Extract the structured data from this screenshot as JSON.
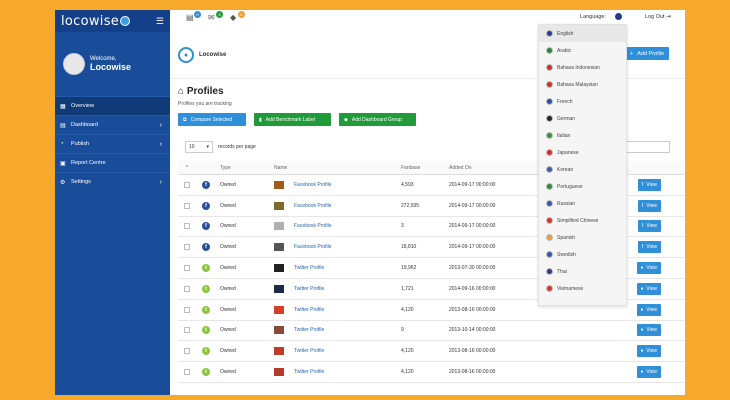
{
  "app": {
    "logo": "locowise"
  },
  "user": {
    "welcome": "Welcome,",
    "name": "Locowise"
  },
  "sidebar": {
    "items": [
      {
        "label": "Overview",
        "icon": "grid-icon",
        "active": true,
        "chevron": false
      },
      {
        "label": "Dashboard",
        "icon": "dashboard-icon",
        "active": false,
        "chevron": true
      },
      {
        "label": "Publish",
        "icon": "publish-icon",
        "active": false,
        "chevron": true
      },
      {
        "label": "Report Centre",
        "icon": "report-icon",
        "active": false,
        "chevron": false
      },
      {
        "label": "Settings",
        "icon": "gear-icon",
        "active": false,
        "chevron": true
      }
    ]
  },
  "topbar": {
    "badges": [
      {
        "icon": "book-icon",
        "count": "0",
        "color": "#2f8fd8"
      },
      {
        "icon": "mail-icon",
        "count": "4",
        "color": "#219a3a"
      },
      {
        "icon": "tag-icon",
        "count": "0",
        "color": "#f0a02a"
      }
    ],
    "language_label": "Language:",
    "logout_label": "Log Out"
  },
  "brand": {
    "name": "Locowise"
  },
  "header": {
    "add_profile_label": "Add Profile"
  },
  "page": {
    "title": "Profiles",
    "subtitle": "Profiles you are tracking",
    "buttons": [
      {
        "label": "Compare Selected",
        "style": "blue"
      },
      {
        "label": "Add Benchmark Label",
        "style": "green"
      },
      {
        "label": "Add Dashboard Group",
        "style": "green"
      }
    ],
    "records_value": "10",
    "records_label": "records per page"
  },
  "table": {
    "headers": [
      "",
      "",
      "Type",
      "Name",
      "Fanbase",
      "Added On",
      ""
    ],
    "view_label": "View",
    "rows": [
      {
        "network": "facebook",
        "type": "Owned",
        "name": "Facebook Profile",
        "fanbase": "4,593",
        "added": "2014-09-17 00:00:00",
        "thumb": "#a15a1a"
      },
      {
        "network": "facebook",
        "type": "Owned",
        "name": "Facebook Profile",
        "fanbase": "272,935",
        "added": "2014-09-17 00:00:00",
        "thumb": "#7b6a2c"
      },
      {
        "network": "facebook",
        "type": "Owned",
        "name": "Facebook Profile",
        "fanbase": "3",
        "added": "2014-09-17 00:00:00",
        "thumb": "#b0b0b0"
      },
      {
        "network": "facebook",
        "type": "Owned",
        "name": "Facebook Profile",
        "fanbase": "18,810",
        "added": "2014-09-17 00:00:00",
        "thumb": "#555"
      },
      {
        "network": "twitter",
        "type": "Owned",
        "name": "Twitter Profile",
        "fanbase": "19,962",
        "added": "2013-07-30 00:00:00",
        "thumb": "#222"
      },
      {
        "network": "twitter",
        "type": "Owned",
        "name": "Twitter Profile",
        "fanbase": "1,721",
        "added": "2014-09-16 00:00:00",
        "thumb": "#1d2a4a"
      },
      {
        "network": "twitter",
        "type": "Owned",
        "name": "Twitter Profile",
        "fanbase": "4,120",
        "added": "2013-08-16 00:00:00",
        "thumb": "#d3412b"
      },
      {
        "network": "twitter",
        "type": "Owned",
        "name": "Twitter Profile",
        "fanbase": "9",
        "added": "2013-10-14 00:00:00",
        "thumb": "#8a4a3a"
      },
      {
        "network": "twitter",
        "type": "Owned",
        "name": "Twitter Profile",
        "fanbase": "4,120",
        "added": "2013-08-16 00:00:00",
        "thumb": "#c43a2a"
      },
      {
        "network": "twitter",
        "type": "Owned",
        "name": "Twitter Profile",
        "fanbase": "4,120",
        "added": "2013-08-16 00:00:00",
        "thumb": "#b53a28"
      }
    ]
  },
  "languages": [
    {
      "label": "English",
      "color": "#1f3f8f"
    },
    {
      "label": "Arabic",
      "color": "#1b8a3a"
    },
    {
      "label": "Bahasa Indonesian",
      "color": "#d42a2a"
    },
    {
      "label": "Bahasa Malaysian",
      "color": "#c8382a"
    },
    {
      "label": "French",
      "color": "#2a4fa8"
    },
    {
      "label": "German",
      "color": "#222222"
    },
    {
      "label": "Italian",
      "color": "#2a9a3a"
    },
    {
      "label": "Japanese",
      "color": "#e02a2a"
    },
    {
      "label": "Korean",
      "color": "#3a5ab0"
    },
    {
      "label": "Portuguese",
      "color": "#2a8a3a"
    },
    {
      "label": "Russian",
      "color": "#3a5ab0"
    },
    {
      "label": "Simplified Chinese",
      "color": "#e0302a"
    },
    {
      "label": "Spanish",
      "color": "#e6a22a"
    },
    {
      "label": "Swedish",
      "color": "#2a5aa8"
    },
    {
      "label": "Thai",
      "color": "#2a3a8a"
    },
    {
      "label": "Vietnamese",
      "color": "#e0302a"
    }
  ]
}
